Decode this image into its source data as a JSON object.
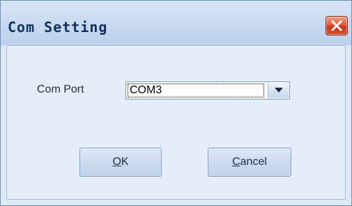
{
  "window": {
    "title": "Com Setting"
  },
  "form": {
    "com_port_label": "Com Port",
    "com_port_value": "COM3"
  },
  "buttons": {
    "ok_mnemonic": "O",
    "ok_rest": "K",
    "cancel_mnemonic": "C",
    "cancel_rest": "ancel"
  },
  "icons": {
    "close": "close-icon",
    "dropdown": "chevron-down-icon"
  },
  "colors": {
    "close_button": "#e2583a",
    "title_text": "#12325e",
    "window_background": "#dfe8f6"
  }
}
